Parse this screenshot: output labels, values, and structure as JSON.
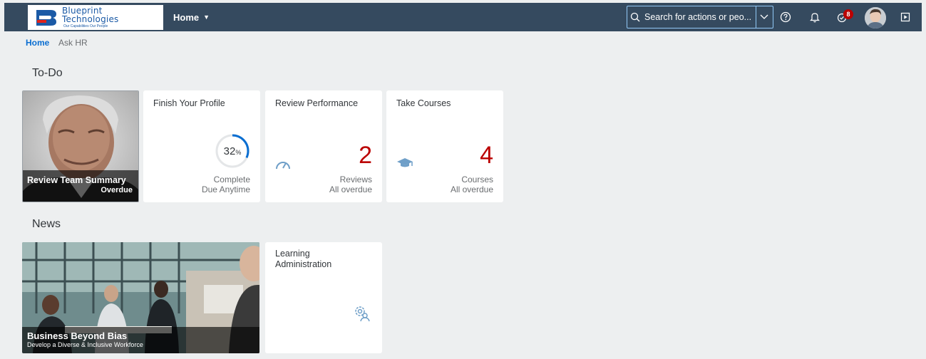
{
  "logo": {
    "line1": "Blueprint",
    "line2": "Technologies",
    "tagline": "Our Capabilities Our People"
  },
  "shell": {
    "home_label": "Home",
    "search_placeholder": "Search for actions or peo...",
    "notification_count": "8"
  },
  "anchors": [
    {
      "label": "Home",
      "active": true
    },
    {
      "label": "Ask HR",
      "active": false
    }
  ],
  "sections": {
    "todo": "To-Do",
    "news": "News"
  },
  "todo_tiles": {
    "review_team": {
      "title": "Review Team Summary",
      "status": "Overdue"
    },
    "finish_profile": {
      "title": "Finish Your Profile",
      "percent": "32",
      "percent_sign": "%",
      "progress": 0.32,
      "footer1": "Complete",
      "footer2": "Due Anytime"
    },
    "review_performance": {
      "title": "Review Performance",
      "count": "2",
      "footer1": "Reviews",
      "footer2": "All overdue"
    },
    "take_courses": {
      "title": "Take Courses",
      "count": "4",
      "footer1": "Courses",
      "footer2": "All overdue"
    }
  },
  "news_tiles": {
    "business_bias": {
      "title": "Business Beyond Bias",
      "subtitle": "Develop a Diverse & Inclusive Workforce"
    },
    "learning_admin": {
      "title_line1": "Learning",
      "title_line2": "Administration"
    }
  },
  "colors": {
    "shell": "#354a5f",
    "accent": "#0a6ed1",
    "negative": "#bb0000",
    "background": "#edeff0"
  },
  "icons": [
    "search-icon",
    "chevron-down-icon",
    "help-icon",
    "bell-icon",
    "notifications-icon",
    "avatar",
    "present-icon",
    "gauge-icon",
    "graduation-cap-icon",
    "settings-person-icon"
  ]
}
